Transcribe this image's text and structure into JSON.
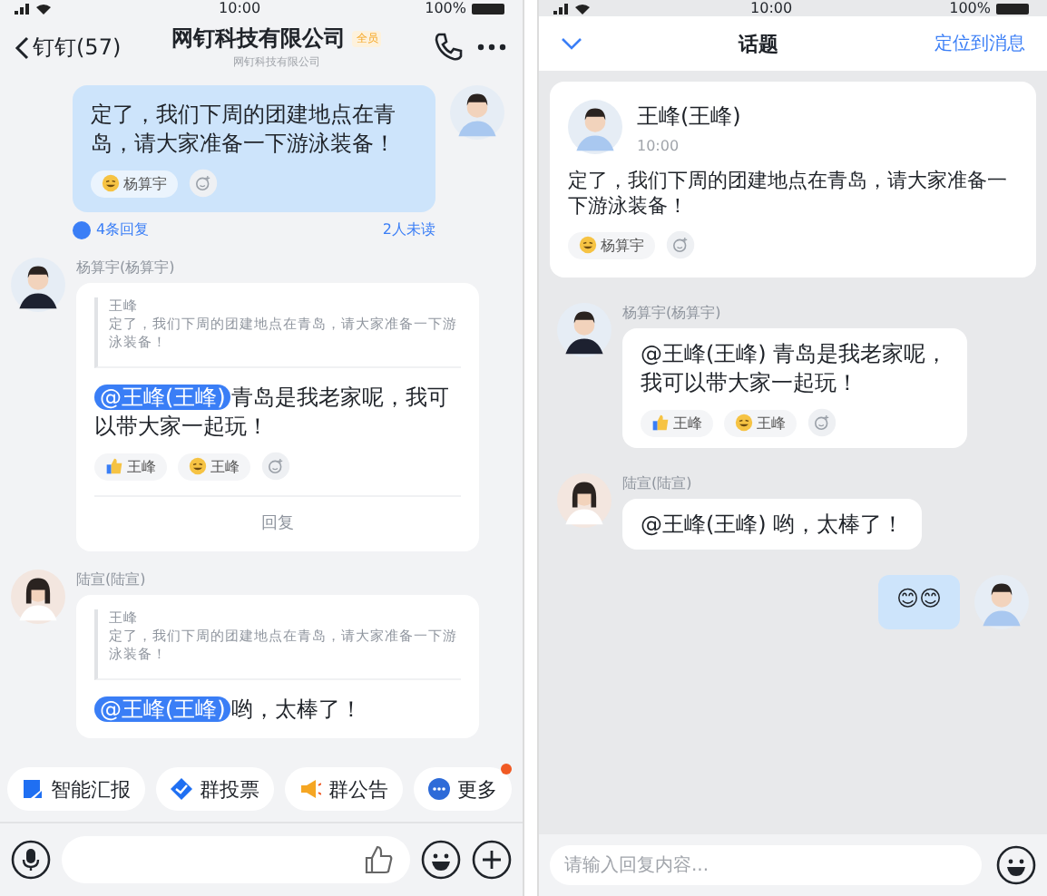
{
  "chat": {
    "status_bar": {
      "time": "10:00",
      "battery": "100%"
    },
    "header": {
      "back": "钉钉(57)",
      "title": "网钉科技有限公司",
      "badge": "全员",
      "subtitle": "网钉科技有限公司"
    },
    "messages": [
      {
        "kind": "own",
        "text": "定了，我们下周的团建地点在青岛，请大家准备一下游泳装备！",
        "reactions": [
          {
            "kind": "laugh",
            "name": "杨算宇"
          }
        ],
        "replies": "4条回复",
        "unread": "2人未读"
      },
      {
        "kind": "card",
        "sender": "杨算宇(杨算宇)",
        "quote_author": "王峰",
        "quote": "定了，我们下周的团建地点在青岛，请大家准备一下游泳装备！",
        "mention": "@王峰(王峰)",
        "text": "青岛是我老家呢，我可以带大家一起玩！",
        "reactions": [
          {
            "kind": "thumb",
            "name": "王峰"
          },
          {
            "kind": "laugh",
            "name": "王峰"
          }
        ],
        "reply": "回复"
      },
      {
        "kind": "card",
        "sender": "陆宣(陆宣)",
        "quote_author": "王峰",
        "quote": "定了，我们下周的团建地点在青岛，请大家准备一下游泳装备！",
        "mention": "@王峰(王峰)",
        "text": "哟，太棒了！"
      }
    ],
    "shortcuts": [
      {
        "label": "智能汇报",
        "kind": "report",
        "dot": false
      },
      {
        "label": "群投票",
        "kind": "vote",
        "dot": false
      },
      {
        "label": "群公告",
        "kind": "announcement",
        "dot": false
      },
      {
        "label": "更多",
        "kind": "more",
        "dot": true
      }
    ]
  },
  "topic": {
    "status_bar": {
      "time": "10:00",
      "battery": "100%"
    },
    "header": {
      "title": "话题",
      "locate": "定位到消息"
    },
    "post": {
      "author": "王峰(王峰)",
      "time": "10:00",
      "text": "定了，我们下周的团建地点在青岛，请大家准备一下游泳装备！",
      "reactions": [
        {
          "kind": "laugh",
          "name": "杨算宇"
        }
      ]
    },
    "replies": [
      {
        "kind": "other",
        "sender": "杨算宇(杨算宇)",
        "text": "@王峰(王峰) 青岛是我老家呢，我可以带大家一起玩！",
        "reactions": [
          {
            "kind": "thumb",
            "name": "王峰"
          },
          {
            "kind": "laugh",
            "name": "王峰"
          }
        ]
      },
      {
        "kind": "other",
        "sender": "陆宣(陆宣)",
        "text": "@王峰(王峰) 哟，太棒了！"
      },
      {
        "kind": "own",
        "text": "😊😊"
      }
    ],
    "input": {
      "placeholder": "请输入回复内容..."
    }
  }
}
